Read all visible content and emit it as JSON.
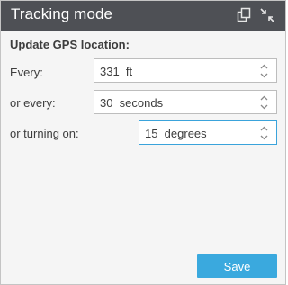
{
  "window": {
    "title": "Tracking mode",
    "icons": [
      "copy-icon",
      "collapse-icon"
    ]
  },
  "form": {
    "section_label": "Update GPS location:",
    "rows": [
      {
        "label": "Every:",
        "value": "331  ft",
        "focused": false
      },
      {
        "label": "or every:",
        "value": "30  seconds",
        "focused": false
      },
      {
        "label": "or turning on:",
        "value": "15  degrees",
        "focused": true
      }
    ]
  },
  "actions": {
    "save_label": "Save"
  },
  "colors": {
    "titlebar": "#4e5055",
    "panel": "#f5f5f5",
    "accent": "#3aa9de",
    "focus_border": "#3aa3db"
  }
}
